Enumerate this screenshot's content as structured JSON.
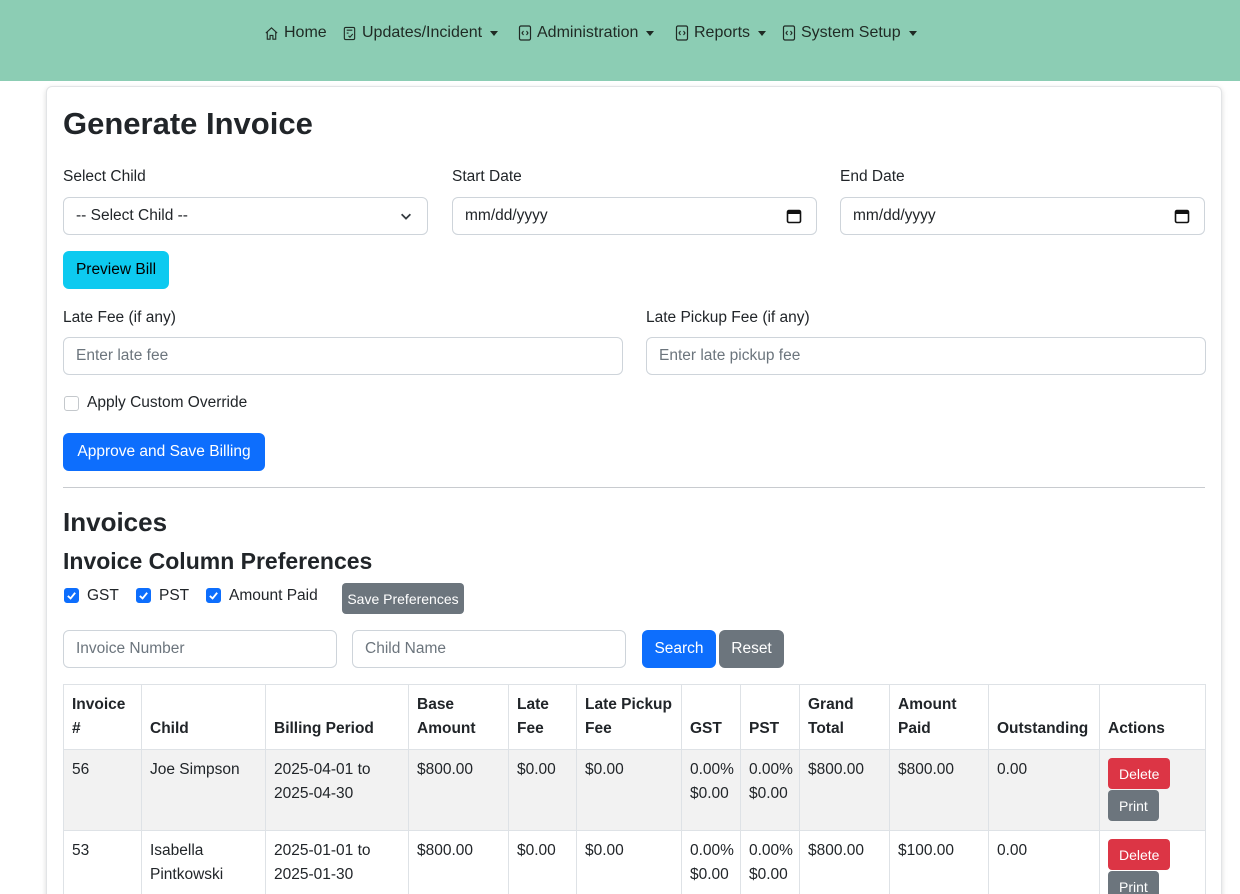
{
  "nav": {
    "items": [
      {
        "label": "Home",
        "icon": "house-icon",
        "dropdown": false
      },
      {
        "label": "Updates/Incident",
        "icon": "clipboard-check-icon",
        "dropdown": true
      },
      {
        "label": "Administration",
        "icon": "file-code-icon",
        "dropdown": true
      },
      {
        "label": "Reports",
        "icon": "file-code-icon",
        "dropdown": true
      },
      {
        "label": "System Setup",
        "icon": "file-code-icon",
        "dropdown": true
      }
    ]
  },
  "form": {
    "title": "Generate Invoice",
    "select_child_label": "Select Child",
    "select_child_value": "-- Select Child --",
    "start_date_label": "Start Date",
    "start_date_placeholder": "mm/dd/yyyy",
    "end_date_label": "End Date",
    "end_date_placeholder": "mm/dd/yyyy",
    "preview_button": "Preview Bill",
    "late_fee_label": "Late Fee (if any)",
    "late_fee_placeholder": "Enter late fee",
    "late_pickup_label": "Late Pickup Fee (if any)",
    "late_pickup_placeholder": "Enter late pickup fee",
    "override_label": "Apply Custom Override",
    "override_checked": false,
    "approve_button": "Approve and Save Billing"
  },
  "invoices": {
    "title": "Invoices",
    "prefs_title": "Invoice Column Preferences",
    "prefs": [
      {
        "label": "GST",
        "checked": true
      },
      {
        "label": "PST",
        "checked": true
      },
      {
        "label": "Amount Paid",
        "checked": true
      }
    ],
    "save_prefs_button": "Save Preferences",
    "search": {
      "invoice_placeholder": "Invoice Number",
      "child_placeholder": "Child Name",
      "search_button": "Search",
      "reset_button": "Reset"
    },
    "columns": [
      "Invoice #",
      "Child",
      "Billing Period",
      "Base Amount",
      "Late Fee",
      "Late Pickup Fee",
      "GST",
      "PST",
      "Grand Total",
      "Amount Paid",
      "Outstanding",
      "Actions"
    ],
    "rows": [
      {
        "invoice": "56",
        "child": "Joe Simpson",
        "period_start": "2025-04-01 to",
        "period_end": "2025-04-30",
        "base": "$800.00",
        "late_fee": "$0.00",
        "late_pickup": "$0.00",
        "gst_rate": "0.00%",
        "gst_amount": "$0.00",
        "pst_rate": "0.00%",
        "pst_amount": "$0.00",
        "grand_total": "$800.00",
        "amount_paid": "$800.00",
        "outstanding": "0.00",
        "delete_label": "Delete",
        "print_label": "Print"
      },
      {
        "invoice": "53",
        "child": "Isabella Pintkowski",
        "period_start": "2025-01-01 to",
        "period_end": "2025-01-30",
        "base": "$800.00",
        "late_fee": "$0.00",
        "late_pickup": "$0.00",
        "gst_rate": "0.00%",
        "gst_amount": "$0.00",
        "pst_rate": "0.00%",
        "pst_amount": "$0.00",
        "grand_total": "$800.00",
        "amount_paid": "$100.00",
        "outstanding": "0.00",
        "delete_label": "Delete",
        "print_label": "Print"
      }
    ]
  },
  "colors": {
    "navbar": "#8ccdb4",
    "primary": "#0d6efd",
    "info": "#0dcaf0",
    "secondary": "#6c757d",
    "danger": "#dc3545"
  }
}
